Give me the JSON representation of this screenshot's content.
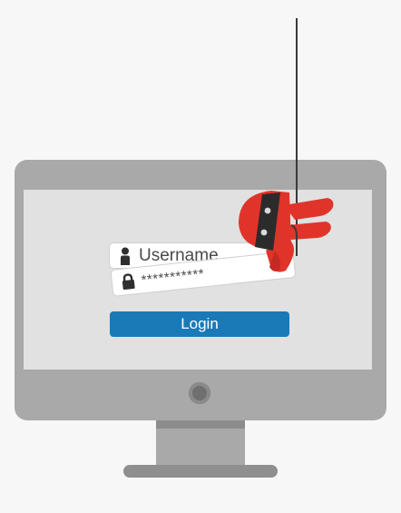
{
  "login_form": {
    "username_placeholder": "Username",
    "password_masked": "***********",
    "login_label": "Login"
  },
  "icons": {
    "user": "user-icon",
    "lock": "lock-icon",
    "power": "power-button"
  },
  "colors": {
    "background": "#f7f7f7",
    "monitor": "#a9a9a9",
    "screen": "#e1e1e1",
    "login_button": "#1a7ab8",
    "thief": "#e0342a"
  }
}
